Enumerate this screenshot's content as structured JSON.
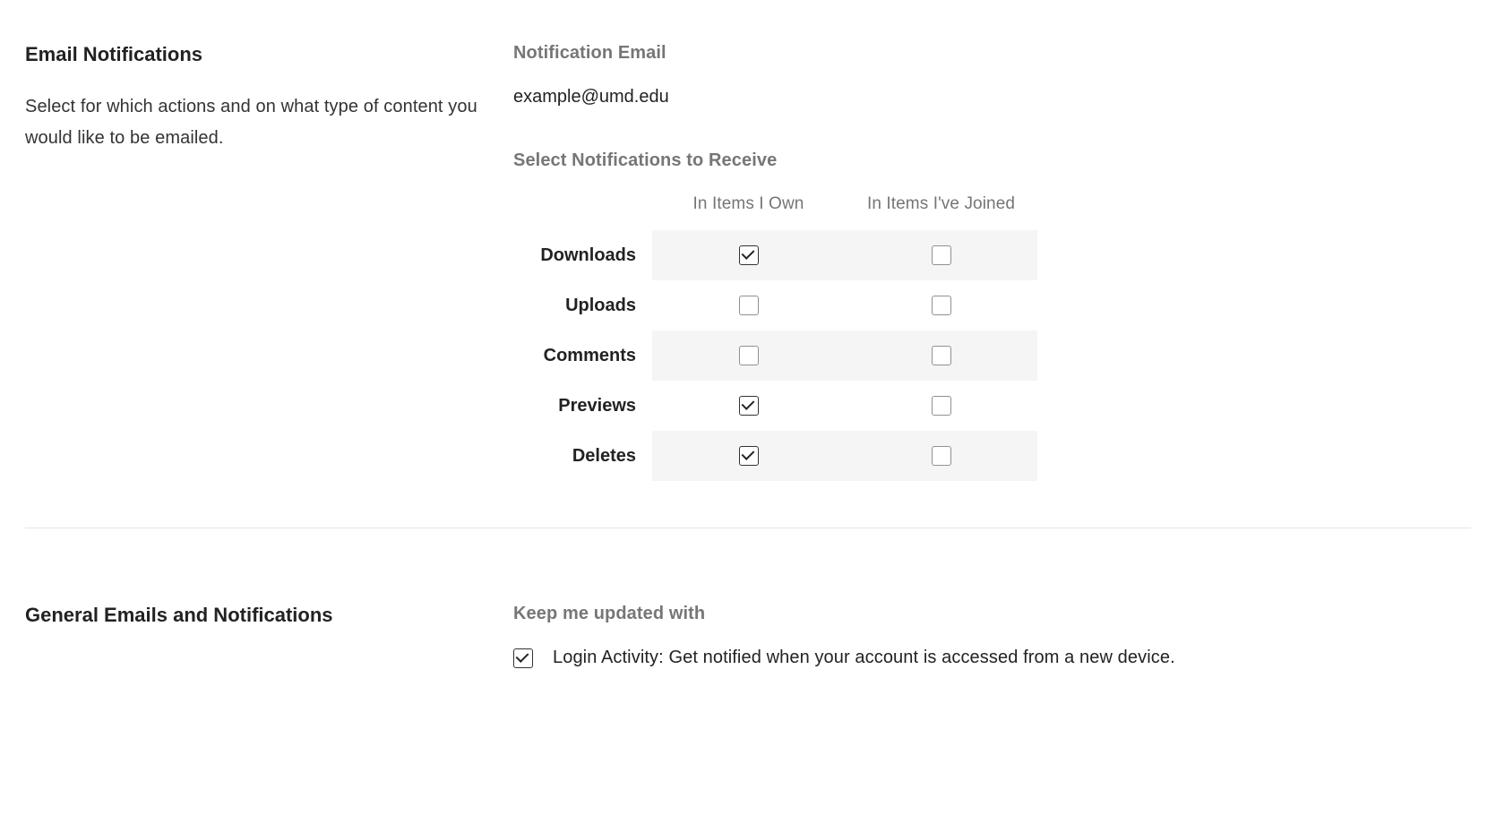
{
  "emailNotifications": {
    "title": "Email Notifications",
    "description": "Select for which actions and on what type of content you would like to be emailed.",
    "notificationEmailLabel": "Notification Email",
    "notificationEmail": "example@umd.edu",
    "selectLabel": "Select Notifications to Receive",
    "columns": {
      "own": "In Items I Own",
      "joined": "In Items I've Joined"
    },
    "rows": [
      {
        "label": "Downloads",
        "own": true,
        "joined": false
      },
      {
        "label": "Uploads",
        "own": false,
        "joined": false
      },
      {
        "label": "Comments",
        "own": false,
        "joined": false
      },
      {
        "label": "Previews",
        "own": true,
        "joined": false
      },
      {
        "label": "Deletes",
        "own": true,
        "joined": false
      }
    ]
  },
  "general": {
    "title": "General Emails and Notifications",
    "keepUpdatedLabel": "Keep me updated with",
    "loginActivity": {
      "label": "Login Activity: Get notified when your account is accessed from a new device.",
      "checked": true
    }
  }
}
